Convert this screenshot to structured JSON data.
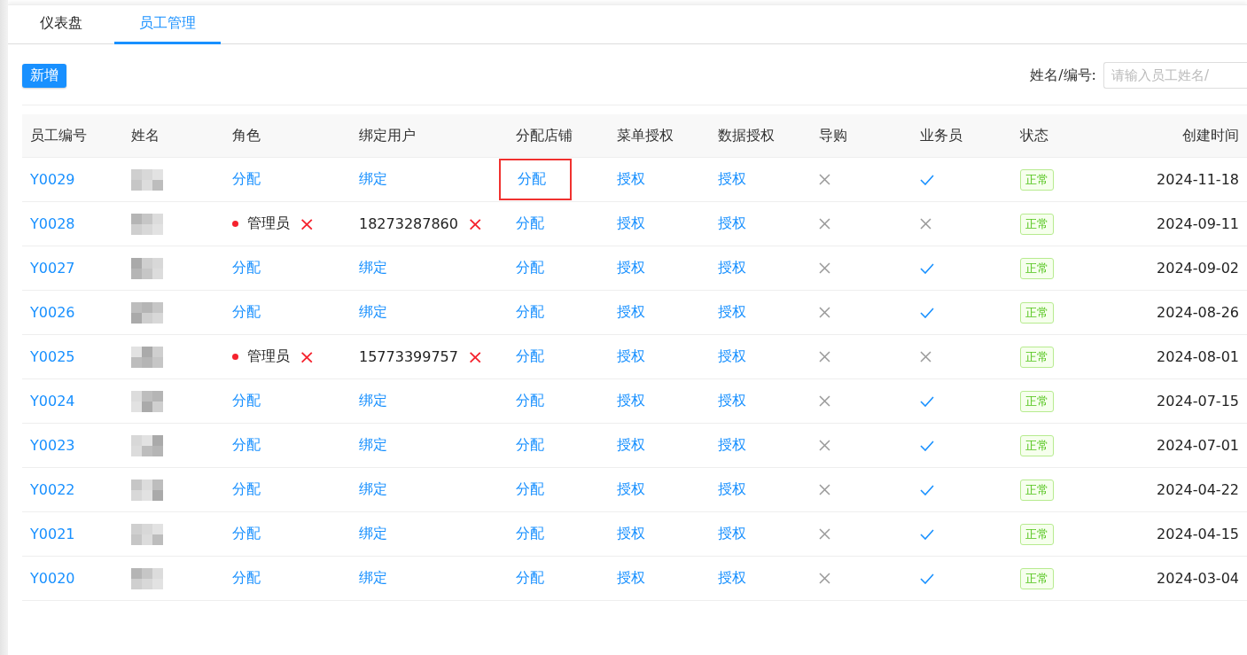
{
  "tabs": [
    {
      "label": "仪表盘",
      "selected": false
    },
    {
      "label": "员工管理",
      "selected": true
    }
  ],
  "toolbar": {
    "add_button": "新增",
    "search_label": "姓名/编号:",
    "search": {
      "placeholder": "请输入员工姓名/"
    }
  },
  "table": {
    "columns": [
      "员工编号",
      "姓名",
      "角色",
      "绑定用户",
      "分配店铺",
      "菜单授权",
      "数据授权",
      "导购",
      "业务员",
      "状态",
      "创建时间"
    ],
    "rows": [
      {
        "id": "Y0029",
        "role": {
          "kind": "link",
          "text": "分配"
        },
        "user": {
          "kind": "link",
          "text": "绑定"
        },
        "store": {
          "text": "分配",
          "highlighted": true
        },
        "menu": "授权",
        "data": "授权",
        "guide": false,
        "salesman": true,
        "status": "正常",
        "created": "2024-11-18"
      },
      {
        "id": "Y0028",
        "role": {
          "kind": "value",
          "text": "管理员",
          "remove": "×"
        },
        "user": {
          "kind": "value",
          "text": "18273287860",
          "remove": "×"
        },
        "store": {
          "text": "分配",
          "highlighted": false
        },
        "menu": "授权",
        "data": "授权",
        "guide": false,
        "salesman": false,
        "status": "正常",
        "created": "2024-09-11"
      },
      {
        "id": "Y0027",
        "role": {
          "kind": "link",
          "text": "分配"
        },
        "user": {
          "kind": "link",
          "text": "绑定"
        },
        "store": {
          "text": "分配",
          "highlighted": false
        },
        "menu": "授权",
        "data": "授权",
        "guide": false,
        "salesman": true,
        "status": "正常",
        "created": "2024-09-02"
      },
      {
        "id": "Y0026",
        "role": {
          "kind": "link",
          "text": "分配"
        },
        "user": {
          "kind": "link",
          "text": "绑定"
        },
        "store": {
          "text": "分配",
          "highlighted": false
        },
        "menu": "授权",
        "data": "授权",
        "guide": false,
        "salesman": true,
        "status": "正常",
        "created": "2024-08-26"
      },
      {
        "id": "Y0025",
        "role": {
          "kind": "value",
          "text": "管理员",
          "remove": "×"
        },
        "user": {
          "kind": "value",
          "text": "15773399757",
          "remove": "×"
        },
        "store": {
          "text": "分配",
          "highlighted": false
        },
        "menu": "授权",
        "data": "授权",
        "guide": false,
        "salesman": false,
        "status": "正常",
        "created": "2024-08-01"
      },
      {
        "id": "Y0024",
        "role": {
          "kind": "link",
          "text": "分配"
        },
        "user": {
          "kind": "link",
          "text": "绑定"
        },
        "store": {
          "text": "分配",
          "highlighted": false
        },
        "menu": "授权",
        "data": "授权",
        "guide": false,
        "salesman": true,
        "status": "正常",
        "created": "2024-07-15"
      },
      {
        "id": "Y0023",
        "role": {
          "kind": "link",
          "text": "分配"
        },
        "user": {
          "kind": "link",
          "text": "绑定"
        },
        "store": {
          "text": "分配",
          "highlighted": false
        },
        "menu": "授权",
        "data": "授权",
        "guide": false,
        "salesman": true,
        "status": "正常",
        "created": "2024-07-01"
      },
      {
        "id": "Y0022",
        "role": {
          "kind": "link",
          "text": "分配"
        },
        "user": {
          "kind": "link",
          "text": "绑定"
        },
        "store": {
          "text": "分配",
          "highlighted": false
        },
        "menu": "授权",
        "data": "授权",
        "guide": false,
        "salesman": true,
        "status": "正常",
        "created": "2024-04-22"
      },
      {
        "id": "Y0021",
        "role": {
          "kind": "link",
          "text": "分配"
        },
        "user": {
          "kind": "link",
          "text": "绑定"
        },
        "store": {
          "text": "分配",
          "highlighted": false
        },
        "menu": "授权",
        "data": "授权",
        "guide": false,
        "salesman": true,
        "status": "正常",
        "created": "2024-04-15"
      },
      {
        "id": "Y0020",
        "role": {
          "kind": "link",
          "text": "分配"
        },
        "user": {
          "kind": "link",
          "text": "绑定"
        },
        "store": {
          "text": "分配",
          "highlighted": false
        },
        "menu": "授权",
        "data": "授权",
        "guide": false,
        "salesman": true,
        "status": "正常",
        "created": "2024-03-04"
      }
    ]
  }
}
